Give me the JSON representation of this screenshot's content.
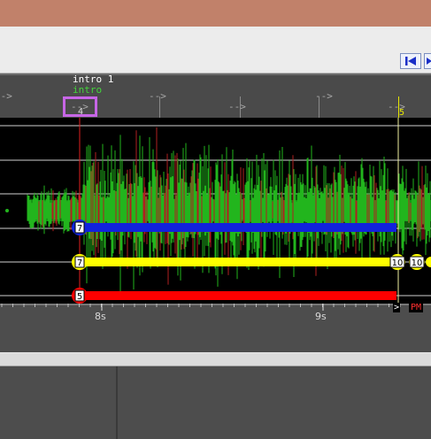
{
  "window": {
    "titlebar_color": "#c1816a"
  },
  "toolbar": {
    "nav_buttons": [
      {
        "icon": "skip-to-start-icon"
      },
      {
        "icon": "play-forward-icon"
      }
    ]
  },
  "ruler": {
    "arrow_glyph": "-->",
    "markers": [
      {
        "label": "intro 1",
        "sublabel": "intro",
        "bar_number": "4",
        "highlight_color": "#c766e6"
      },
      {
        "label": "",
        "sublabel": "",
        "bar_number": "5"
      }
    ]
  },
  "tracks": {
    "colors": {
      "waveform_green": "#22b51d",
      "waveform_dark_green": "#0e7a10",
      "waveform_red": "#b02020"
    },
    "automation_lanes": [
      {
        "color": "#1122dd",
        "start_value": "7",
        "end_value": ""
      },
      {
        "color": "#ffff00",
        "start_value": "7",
        "end_value": "10",
        "extra_value": "10"
      },
      {
        "color": "#ff0000",
        "start_value": "5",
        "end_value": ""
      }
    ]
  },
  "timeline": {
    "time_labels": [
      "8s",
      "9s"
    ],
    "end_label": "PM",
    "end_marker": ">"
  }
}
